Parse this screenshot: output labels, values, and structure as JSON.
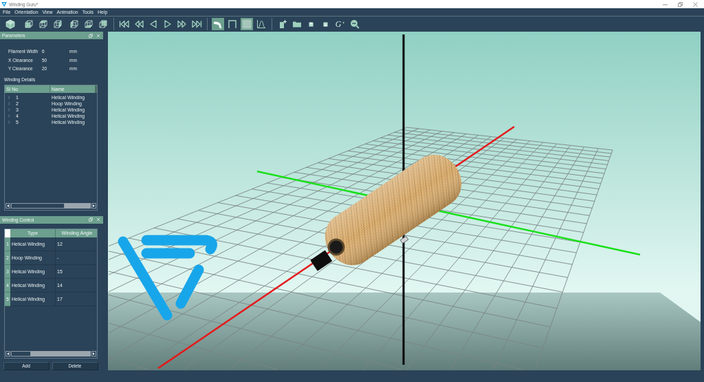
{
  "window": {
    "title": "Winding Guru*"
  },
  "menu": [
    "File",
    "Orientation",
    "View",
    "Animation",
    "Tools",
    "Help"
  ],
  "toolbar": {
    "toggles": [
      {
        "selected": true
      },
      {
        "selected": false
      },
      {
        "selected": true
      },
      {
        "selected": false
      }
    ],
    "letter_button": {
      "label": "G"
    }
  },
  "parameters_panel": {
    "title": "Parameters",
    "fields": [
      {
        "label": "Filament Width",
        "value": "6",
        "unit": "mm"
      },
      {
        "label": "X Clearance",
        "value": "50",
        "unit": "mm"
      },
      {
        "label": "Y Clearance",
        "value": "20",
        "unit": "mm"
      }
    ],
    "winding_details": {
      "title": "Winding Details",
      "columns": [
        "Sl No",
        "Name"
      ],
      "rows": [
        {
          "number": "1",
          "name": "Helical Winding",
          "expanded": false
        },
        {
          "number": "2",
          "name": "Hoop Winding",
          "expanded": false
        },
        {
          "number": "3",
          "name": "Helical Winding",
          "expanded": false
        },
        {
          "number": "4",
          "name": "Helical Winding",
          "expanded": false
        },
        {
          "number": "5",
          "name": "Helical Winding",
          "expanded": false
        }
      ]
    }
  },
  "winding_control_panel": {
    "title": "Winding Control",
    "columns": [
      "Type",
      "Winding Angle"
    ],
    "rows": [
      {
        "row_number": "1",
        "type": "Helical Winding",
        "winding_angle": "12"
      },
      {
        "row_number": "2",
        "type": "Hoop Winding",
        "winding_angle": "-"
      },
      {
        "row_number": "3",
        "type": "Helical Winding",
        "winding_angle": "15"
      },
      {
        "row_number": "4",
        "type": "Helical Winding",
        "winding_angle": "14"
      },
      {
        "row_number": "5",
        "type": "Helical Winding",
        "winding_angle": "17"
      }
    ],
    "buttons": [
      "Add",
      "Delete"
    ]
  }
}
